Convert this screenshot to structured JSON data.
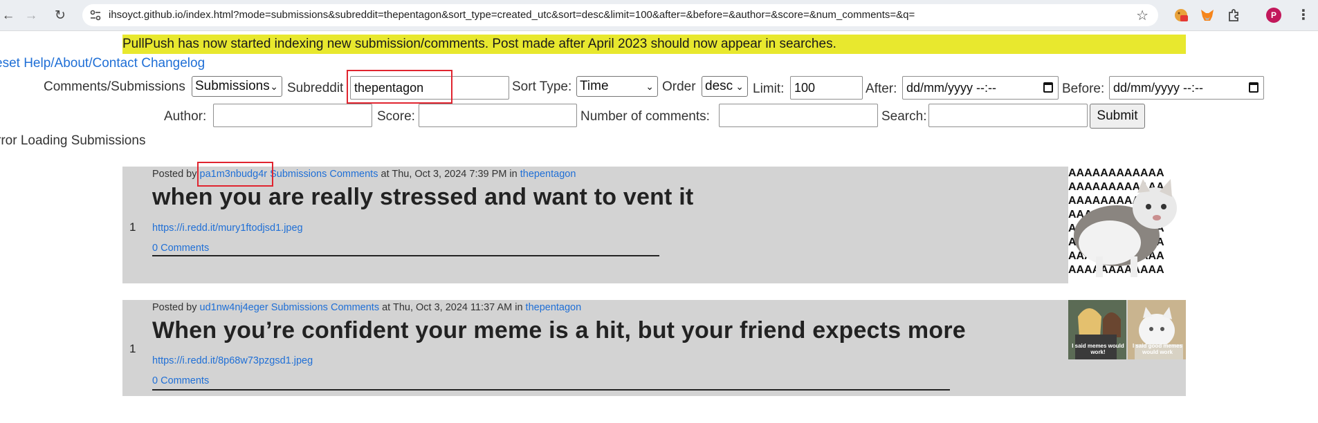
{
  "browser": {
    "url": "ihsoyct.github.io/index.html?mode=submissions&subreddit=thepentagon&sort_type=created_utc&sort=desc&limit=100&after=&before=&author=&score=&num_comments=&q=",
    "profile_initial": "P"
  },
  "banner": "PullPush has now started indexing new submission/comments. Post made after April 2023 should now appear in searches.",
  "links": {
    "reset_help": "eset Help/About/Contact",
    "changelog": "Changelog"
  },
  "form": {
    "mode_label": "Comments/Submissions",
    "mode_value": "Submissions",
    "subreddit_label": "Subreddit",
    "subreddit_value": "thepentagon",
    "sort_type_label": "Sort Type:",
    "sort_type_value": "Time",
    "order_label": "Order",
    "order_value": "desc",
    "limit_label": "Limit:",
    "limit_value": "100",
    "after_label": "After:",
    "after_placeholder": "dd/mm/yyyy --:--",
    "before_label": "Before:",
    "before_placeholder": "dd/mm/yyyy --:--",
    "author_label": "Author:",
    "score_label": "Score:",
    "num_comments_label": "Number of comments:",
    "search_label": "Search:",
    "submit_label": "Submit"
  },
  "status": "rror Loading Submissions",
  "posts": [
    {
      "score": "1",
      "posted_by": "Posted by",
      "author": "pa1m3nbudg4r",
      "submissions": "Submissions",
      "comments": "Comments",
      "at": "at Thu, Oct 3, 2024 7:39 PM in",
      "subreddit": "thepentagon",
      "title": "when you are really stressed and want to vent it",
      "url": "https://i.redd.it/mury1ftodjsd1.jpeg",
      "comment_count": "0 Comments",
      "thumb_text": "AAAAAAAAAAAA"
    },
    {
      "score": "1",
      "posted_by": "Posted by",
      "author": "ud1nw4nj4eger",
      "submissions": "Submissions",
      "comments": "Comments",
      "at": "at Thu, Oct 3, 2024 11:37 AM in",
      "subreddit": "thepentagon",
      "title": "When you’re confident your meme is a hit, but your friend expects more",
      "url": "https://i.redd.it/8p68w73pzgsd1.jpeg",
      "comment_count": "0 Comments",
      "thumb_caption_left": "I said memes would work!",
      "thumb_caption_right": "I said good memes would work"
    }
  ]
}
